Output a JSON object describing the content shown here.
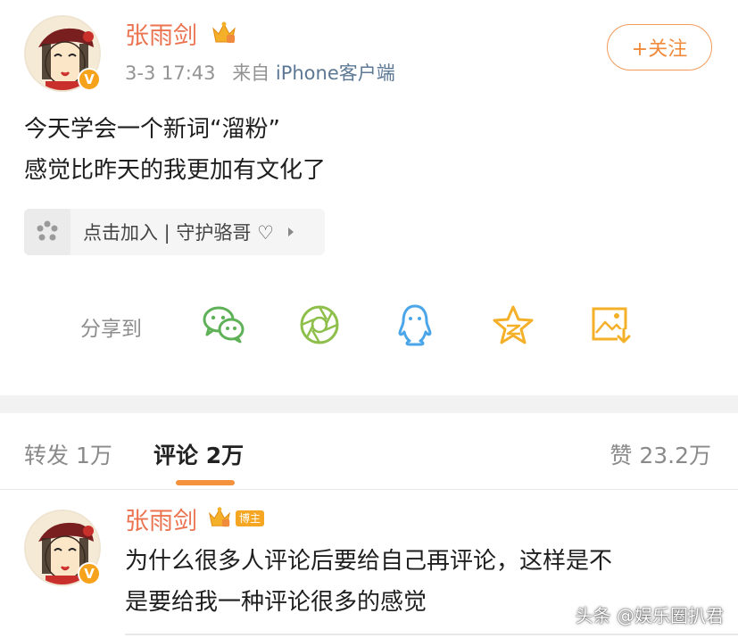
{
  "post": {
    "username": "张雨剑",
    "time": "3-3 17:43",
    "source_prefix": "来自",
    "source": "iPhone客户端",
    "follow_label": "+关注",
    "content_line1": "今天学会一个新词“溜粉”",
    "content_line2": "感觉比昨天的我更加有文化了",
    "chip_text": "点击加入 | 守护骆哥 ♡",
    "share_label": "分享到",
    "share_icons": [
      "wechat-icon",
      "moments-icon",
      "qq-icon",
      "qzone-icon",
      "save-image-icon"
    ]
  },
  "tabs": {
    "repost": "转发 1万",
    "comments": "评论 2万",
    "likes": "赞 23.2万"
  },
  "comment": {
    "username": "张雨剑",
    "badge": "博主",
    "line1": "为什么很多人评论后要给自己再评论，这样是不",
    "line2": "是要给我一种评论很多的感觉"
  },
  "watermark": "头条 @娱乐圈扒君",
  "colors": {
    "username": "#eb7350",
    "accent": "#f4923e",
    "link": "#5d7895",
    "wechat": "#5fb157",
    "moments": "#8dbf4a",
    "qq": "#4aa6e8",
    "qzone": "#f5b02a"
  }
}
